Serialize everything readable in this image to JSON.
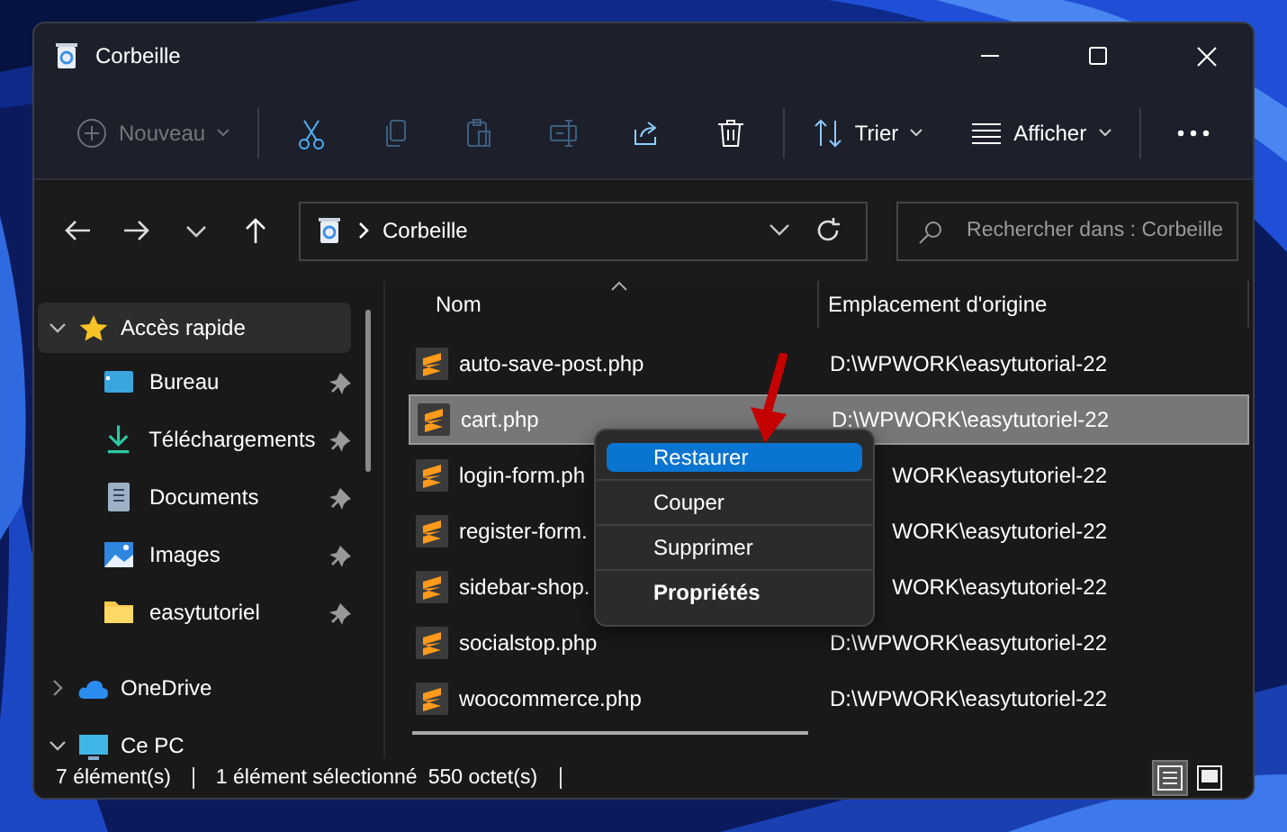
{
  "window": {
    "title": "Corbeille"
  },
  "toolbar": {
    "new_button": {
      "label": "Nouveau",
      "disabled": true
    },
    "icon_buttons": [
      {
        "disabled": false
      },
      {
        "disabled": true
      },
      {
        "disabled": true
      },
      {
        "disabled": true
      },
      {
        "disabled": false
      },
      {
        "disabled": false
      }
    ],
    "sort_button": {
      "label": "Trier"
    },
    "view_button": {
      "label": "Afficher"
    }
  },
  "address_bar": {
    "path": "Corbeille"
  },
  "search": {
    "placeholder": "Rechercher dans : Corbeille"
  },
  "sidebar": {
    "items": [
      {
        "label": "Accès rapide",
        "expanded": true,
        "selected": true,
        "children": [
          {
            "label": "Bureau",
            "pinned": true
          },
          {
            "label": "Téléchargements",
            "pinned": true
          },
          {
            "label": "Documents",
            "pinned": true
          },
          {
            "label": "Images",
            "pinned": true
          },
          {
            "label": "easytutoriel",
            "pinned": true
          }
        ]
      },
      {
        "label": "OneDrive",
        "expanded": false,
        "selected": false
      },
      {
        "label": "Ce PC",
        "expanded": true,
        "selected": false
      }
    ]
  },
  "table": {
    "columns": [
      {
        "label": "Nom",
        "sorted": true
      },
      {
        "label": "Emplacement d'origine",
        "sorted": false
      }
    ],
    "rows": [
      {
        "name": "auto-save-post.php",
        "location": "D:\\WPWORK\\easytutorial-22",
        "selected": false
      },
      {
        "name": "cart.php",
        "location": "D:\\WPWORK\\easytutoriel-22",
        "selected": true
      },
      {
        "name": "login-form.ph",
        "location": "WORK\\easytutoriel-22",
        "selected": false
      },
      {
        "name": "register-form.",
        "location": "WORK\\easytutoriel-22",
        "selected": false
      },
      {
        "name": "sidebar-shop.",
        "location": "WORK\\easytutoriel-22",
        "selected": false
      },
      {
        "name": "socialstop.php",
        "location": "D:\\WPWORK\\easytutoriel-22",
        "selected": false
      },
      {
        "name": "woocommerce.php",
        "location": "D:\\WPWORK\\easytutoriel-22",
        "selected": false
      }
    ]
  },
  "context_menu": {
    "items": [
      {
        "label": "Restaurer",
        "selected": true,
        "default": false
      },
      {
        "label": "Couper",
        "selected": false,
        "default": false
      },
      {
        "label": "Supprimer",
        "selected": false,
        "default": false
      },
      {
        "label": "Propriétés",
        "selected": false,
        "default": true
      }
    ]
  },
  "status_bar": {
    "item_count": "7 élément(s)",
    "selection": "1 élément sélectionné",
    "size": "550 octet(s)",
    "view_buttons": [
      {
        "selected": true
      },
      {
        "selected": false
      }
    ]
  }
}
